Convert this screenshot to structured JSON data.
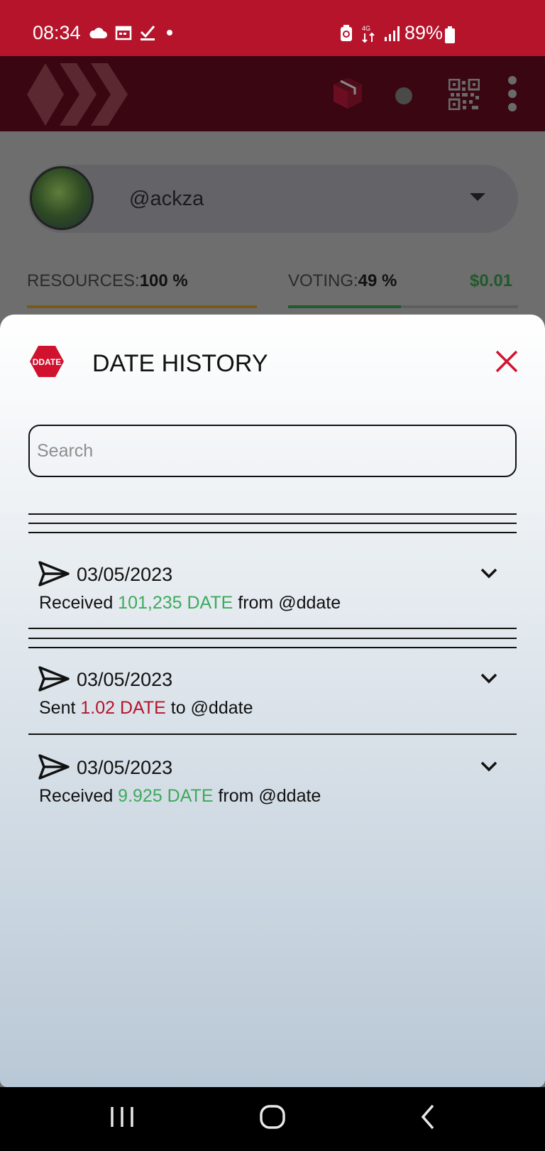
{
  "status_bar": {
    "time": "08:34",
    "battery": "89%",
    "icons_left": [
      "cloud-icon",
      "calendar-icon",
      "check-icon",
      "dot-icon"
    ],
    "icons_right": [
      "battery-saver-icon",
      "data-arrows-icon",
      "signal-icon",
      "battery-icon"
    ]
  },
  "app_bar": {
    "icons": [
      "hive-logo",
      "cube-icon",
      "status-dot-icon",
      "qr-code-icon",
      "more-vert-icon"
    ]
  },
  "account": {
    "username": "@ackza"
  },
  "resources": {
    "resources_label": "RESOURCES:",
    "resources_value": "100 %",
    "resources_level": 1.0,
    "voting_label": "VOTING:",
    "voting_value": "49 %",
    "voting_level": 0.49,
    "vote_value": "$0.01",
    "colors": {
      "resources": "#7a5a12",
      "voting": "#1f5c2a"
    }
  },
  "sheet": {
    "logo_text": "DDATE",
    "title": "DATE HISTORY",
    "search_placeholder": "Search",
    "transactions": [
      {
        "date": "03/05/2023",
        "prefix": "Received ",
        "amount": "101,235 DATE",
        "suffix": " from @ddate",
        "direction": "in"
      },
      {
        "date": "03/05/2023",
        "prefix": "Sent ",
        "amount": "1.02 DATE",
        "suffix": " to @ddate",
        "direction": "out"
      },
      {
        "date": "03/05/2023",
        "prefix": "Received ",
        "amount": "9.925 DATE",
        "suffix": " from @ddate",
        "direction": "in"
      }
    ],
    "colors": {
      "received": "#3daa5b",
      "sent": "#b5142b",
      "accent": "#d0122f"
    }
  },
  "nav_bar": {
    "icons": [
      "recents-icon",
      "home-icon",
      "back-icon"
    ]
  }
}
